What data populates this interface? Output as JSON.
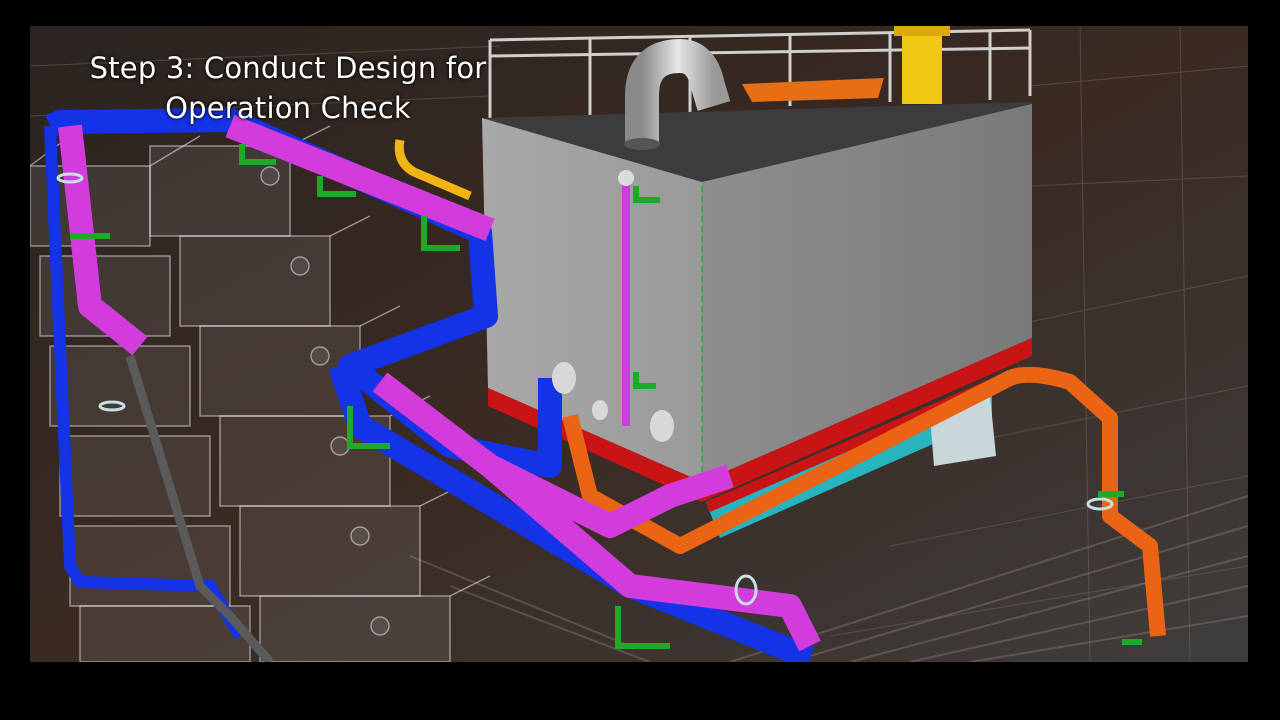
{
  "caption": {
    "line1": "Step 3: Conduct Design for",
    "line2": "Operation Check"
  },
  "colors": {
    "frame": "#000000",
    "tank": "#a6a6a6",
    "tank_roof": "#3c3c3c",
    "base_red": "#c81414",
    "base_cyan": "#28b4be",
    "pipe_blue": "#1432e6",
    "pipe_magenta": "#d23cdc",
    "pipe_orange": "#eb6414",
    "pipe_yellow": "#f0b414",
    "pipe_gray": "#5a5a5a",
    "support_green": "#1eaa28",
    "stack_yellow": "#f0c814",
    "hatch_orange": "#e66e14"
  }
}
